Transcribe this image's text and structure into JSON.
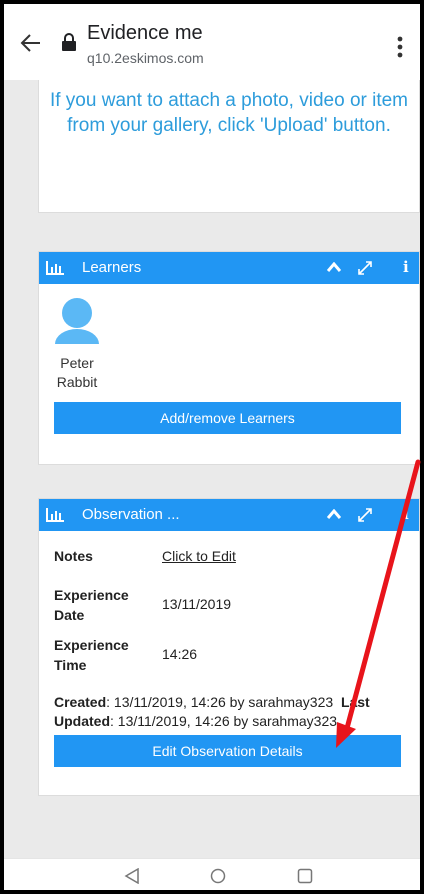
{
  "browser": {
    "title": "Evidence me",
    "url": "q10.2eskimos.com"
  },
  "upload_card": {
    "message": "If you want to attach a photo, video or item from your gallery, click 'Upload' button."
  },
  "learners_panel": {
    "title": "Learners",
    "learners": [
      {
        "name": "Peter Rabbit"
      }
    ],
    "button_label": "Add/remove Learners"
  },
  "observation_panel": {
    "title": "Observation ...",
    "rows": [
      {
        "label": "Notes",
        "value": "Click to Edit"
      },
      {
        "label": "Experience Date",
        "value": "13/11/2019"
      },
      {
        "label": "Experience Time",
        "value": "14:26"
      }
    ],
    "created_label": "Created",
    "created_value": ": 13/11/2019, 14:26 by sarahmay323",
    "last_label": "Last",
    "updated_label": "Updated",
    "updated_value": ": 13/11/2019, 14:26 by sarahmay323",
    "button_label": "Edit Observation Details"
  },
  "colors": {
    "accent": "#2196f3",
    "link_text": "#2d9cdb",
    "annotation": "#e8141b"
  },
  "icons": {
    "back": "back-arrow-icon",
    "lock": "lock-icon",
    "menu": "more-vert-icon",
    "panel": "bar-chart-icon",
    "collapse": "chevron-up-icon",
    "expand": "expand-icon",
    "info": "info-icon",
    "avatar": "person-avatar-icon",
    "nav_back": "nav-back-icon",
    "nav_home": "nav-home-icon",
    "nav_recent": "nav-recent-icon"
  }
}
